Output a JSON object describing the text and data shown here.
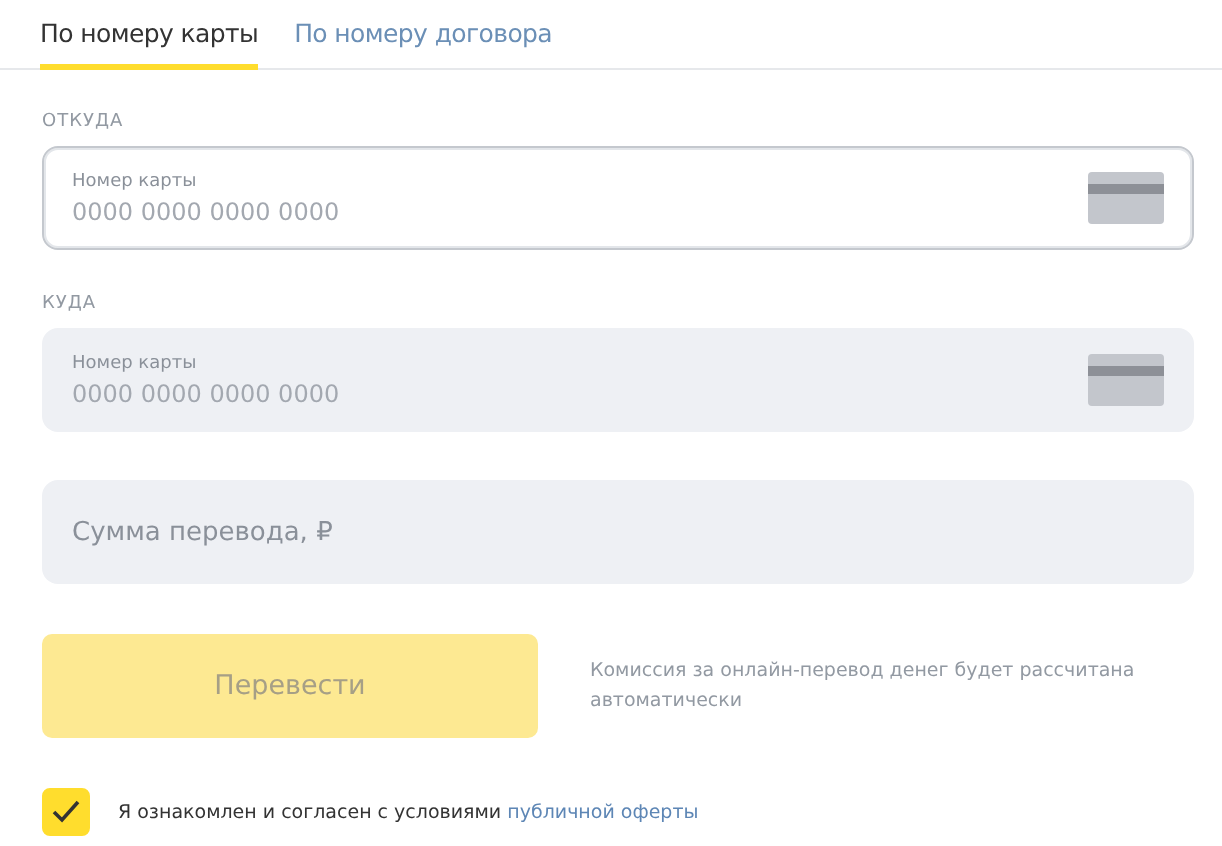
{
  "tabs": [
    {
      "label": "По номеру карты",
      "selected": true
    },
    {
      "label": "По номеру договора",
      "selected": false
    }
  ],
  "fields": [
    {
      "kind": "card",
      "section": "ОТКУДА",
      "label": "Номер карты",
      "placeholder": "0000 0000 0000 0000",
      "active": true
    },
    {
      "kind": "card",
      "section": "КУДА",
      "label": "Номер карты",
      "placeholder": "0000 0000 0000 0000",
      "active": false
    },
    {
      "kind": "amount",
      "placeholder": "Сумма перевода, ₽",
      "active": false
    }
  ],
  "submit": {
    "label": "Перевести",
    "disabled": true
  },
  "commission_note": "Комиссия за онлайн-перевод денег будет рассчитана автоматически",
  "agreement": {
    "checked": true,
    "text": "Я ознакомлен и согласен с условиями",
    "link": "публичной оферты"
  }
}
